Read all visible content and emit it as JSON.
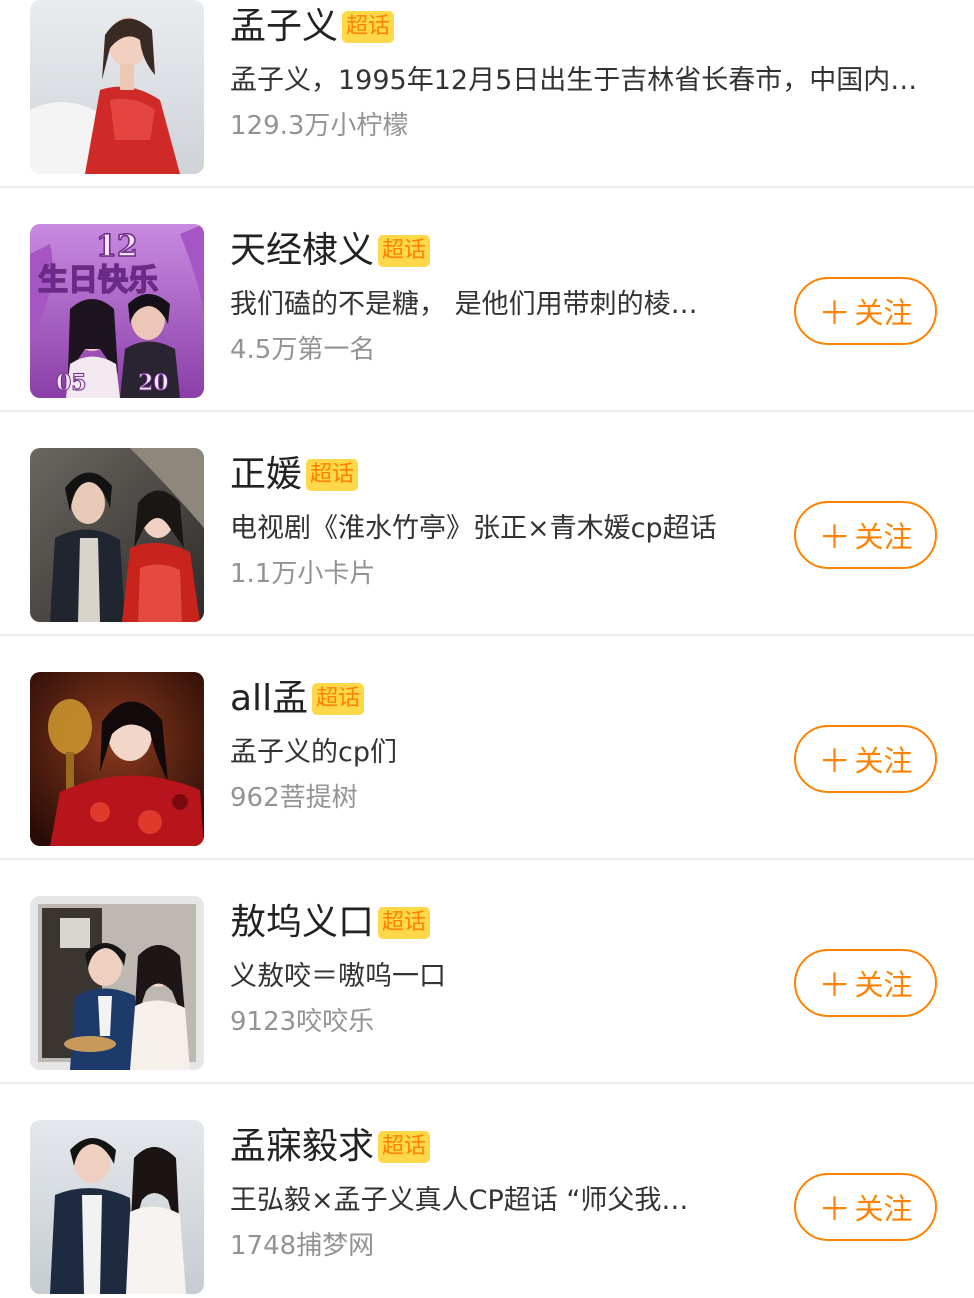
{
  "colors": {
    "accent": "#ff8200",
    "tag_bg": "#ffd84a",
    "meta_text": "#939393",
    "divider": "#ececec"
  },
  "tag_label": "超话",
  "follow_label": "关注",
  "items": [
    {
      "title": "孟子义",
      "desc": "孟子义，1995年12月5日出生于吉林省长春市，中国内…",
      "meta": "129.3万小柠檬",
      "has_follow": false,
      "thumb": "portrait-red-dress"
    },
    {
      "title": "天经棣义",
      "desc": "我们磕的不是糖， 是他们用带刺的棱…",
      "meta": "4.5万第一名",
      "has_follow": true,
      "thumb": "birthday-poster",
      "thumb_text": {
        "line1": "12",
        "line2": "生日快乐",
        "left": "05",
        "right": "20"
      }
    },
    {
      "title": "正媛",
      "desc": "电视剧《淮水竹亭》张正×青木媛cp超话",
      "meta": "1.1万小卡片",
      "has_follow": true,
      "thumb": "drama-couple"
    },
    {
      "title": "all孟",
      "desc": "孟子义的cp们",
      "meta": "962菩提树",
      "has_follow": true,
      "thumb": "red-costume-portrait"
    },
    {
      "title": "敖坞义口",
      "desc": "义敖咬＝嗷呜一口",
      "meta": "9123咬咬乐",
      "has_follow": true,
      "thumb": "couple-photo-frame"
    },
    {
      "title": "孟寐毅求",
      "desc": "王弘毅×孟子义真人CP超话 “师父我…",
      "meta": "1748捕梦网",
      "has_follow": true,
      "thumb": "couple-standing"
    }
  ]
}
